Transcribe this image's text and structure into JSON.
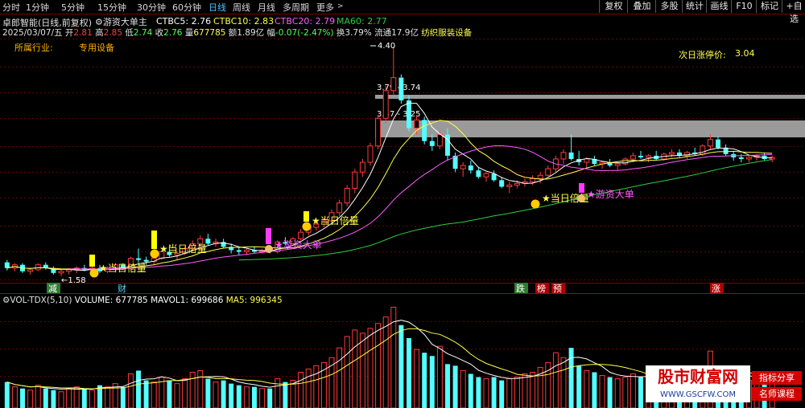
{
  "toolbar": {
    "periods": [
      "分时",
      "1分钟",
      "5分钟",
      "15分钟",
      "30分钟",
      "60分钟",
      "日线",
      "周线",
      "月线",
      "多周期",
      "更多"
    ],
    "active_period": "日线",
    "right_buttons": [
      "复权",
      "叠加",
      "多股",
      "统计",
      "画线",
      "F10",
      "标记",
      "+自选"
    ]
  },
  "header": {
    "stock_title": "卓郎智能(日线,前复权)",
    "indicator_name": "游资大单主",
    "ctbc5_label": "CTBC5: 2.76",
    "ctbc10_label": "CTBC10: 2.83",
    "ctbc20_label": "CTBC20: 2.79",
    "ma60_label": "MA60: 2.77",
    "date": "2025/03/07/五",
    "open_label": "开",
    "open": "2.81",
    "high_label": "高",
    "high": "2.85",
    "low_label": "低",
    "low": "2.74",
    "close_label": "收",
    "close": "2.76",
    "volume_label": "量",
    "volume": "677785",
    "amount_label": "额",
    "amount": "1.89亿",
    "change_label": "幅",
    "change": "-0.07(-2.47%)",
    "turnover_label": "换",
    "turnover": "3.79%",
    "float_label": "流通",
    "float_shares": "17.9亿",
    "sector": "纺织服装设备"
  },
  "info": {
    "industry_label": "所属行业:",
    "industry": "专用设备",
    "limit_label": "次日涨停价:",
    "limit_price": "3.04"
  },
  "annotations": {
    "max_price": "4.40",
    "min_price": "1.58",
    "zone1": "3.79 - 3.74",
    "zone2": "3.47 - 3.25",
    "signal_double": "当日倍量",
    "signal_hot": "游资大单"
  },
  "bottom_tags": [
    "减",
    "财",
    "跌",
    "榜",
    "预",
    "涨"
  ],
  "volume_panel": {
    "title": "VOL-TDX(5,10)",
    "volume_label": "VOLUME: 677785",
    "mavol1_label": "MAVOL1: 699686",
    "ma5_label": "MA5: 996345"
  },
  "watermark": {
    "site": "股市财富网",
    "url": "WWW.GSCFW.COM",
    "tag1": "指标分享",
    "tag2": "名师课程"
  },
  "colors": {
    "up": "#ff3b3b",
    "down": "#54ffff",
    "ma5": "#ffffff",
    "ma10": "#ffff4a",
    "ma20": "#ff5cff",
    "ma60": "#2ecc40",
    "zone": "#9a9a9a"
  },
  "chart_data": {
    "type": "candlestick",
    "price_range": [
      1.5,
      4.5
    ],
    "candles": [
      [
        1.75,
        1.78,
        1.65,
        1.68
      ],
      [
        1.68,
        1.74,
        1.64,
        1.72
      ],
      [
        1.72,
        1.74,
        1.62,
        1.64
      ],
      [
        1.64,
        1.68,
        1.6,
        1.66
      ],
      [
        1.66,
        1.74,
        1.64,
        1.72
      ],
      [
        1.72,
        1.75,
        1.66,
        1.68
      ],
      [
        1.68,
        1.7,
        1.6,
        1.62
      ],
      [
        1.62,
        1.66,
        1.58,
        1.64
      ],
      [
        1.64,
        1.68,
        1.6,
        1.66
      ],
      [
        1.66,
        1.7,
        1.62,
        1.68
      ],
      [
        1.68,
        1.72,
        1.64,
        1.66
      ],
      [
        1.66,
        1.7,
        1.62,
        1.68
      ],
      [
        1.68,
        1.72,
        1.62,
        1.64
      ],
      [
        1.64,
        1.7,
        1.62,
        1.68
      ],
      [
        1.68,
        1.74,
        1.66,
        1.72
      ],
      [
        1.72,
        1.74,
        1.66,
        1.68
      ],
      [
        1.68,
        1.82,
        1.66,
        1.8
      ],
      [
        1.8,
        1.92,
        1.74,
        1.78
      ],
      [
        1.78,
        1.82,
        1.72,
        1.76
      ],
      [
        1.76,
        1.82,
        1.72,
        1.8
      ],
      [
        1.8,
        1.9,
        1.78,
        1.88
      ],
      [
        1.88,
        1.96,
        1.82,
        1.84
      ],
      [
        1.84,
        1.88,
        1.78,
        1.86
      ],
      [
        1.86,
        1.94,
        1.84,
        1.92
      ],
      [
        1.92,
        2.02,
        1.88,
        1.98
      ],
      [
        1.98,
        2.08,
        1.94,
        2.04
      ],
      [
        2.04,
        2.1,
        1.96,
        1.98
      ],
      [
        1.98,
        2.04,
        1.94,
        2.0
      ],
      [
        2.0,
        2.04,
        1.92,
        1.94
      ],
      [
        1.94,
        1.98,
        1.86,
        1.9
      ],
      [
        1.9,
        1.94,
        1.84,
        1.88
      ],
      [
        1.88,
        1.92,
        1.84,
        1.9
      ],
      [
        1.9,
        1.94,
        1.86,
        1.88
      ],
      [
        1.88,
        1.92,
        1.86,
        1.9
      ],
      [
        1.9,
        1.92,
        1.86,
        1.88
      ],
      [
        1.88,
        2.02,
        1.86,
        2.0
      ],
      [
        2.0,
        2.06,
        1.96,
        1.98
      ],
      [
        1.98,
        2.06,
        1.96,
        2.04
      ],
      [
        2.04,
        2.16,
        2.02,
        2.12
      ],
      [
        2.12,
        2.22,
        2.08,
        2.18
      ],
      [
        2.18,
        2.26,
        2.14,
        2.22
      ],
      [
        2.22,
        2.3,
        2.18,
        2.26
      ],
      [
        2.26,
        2.4,
        2.24,
        2.36
      ],
      [
        2.36,
        2.52,
        2.32,
        2.48
      ],
      [
        2.48,
        2.7,
        2.44,
        2.66
      ],
      [
        2.66,
        2.9,
        2.6,
        2.86
      ],
      [
        2.86,
        3.02,
        2.8,
        2.98
      ],
      [
        2.98,
        3.22,
        2.94,
        3.18
      ],
      [
        3.18,
        3.56,
        3.14,
        3.52
      ],
      [
        3.52,
        3.92,
        3.46,
        3.86
      ],
      [
        3.86,
        4.4,
        3.8,
        4.02
      ],
      [
        4.02,
        4.06,
        3.7,
        3.74
      ],
      [
        3.74,
        3.8,
        3.36,
        3.4
      ],
      [
        3.4,
        3.56,
        3.32,
        3.5
      ],
      [
        3.5,
        3.54,
        3.2,
        3.24
      ],
      [
        3.24,
        3.32,
        3.12,
        3.18
      ],
      [
        3.18,
        3.36,
        3.14,
        3.32
      ],
      [
        3.32,
        3.4,
        3.0,
        3.06
      ],
      [
        3.06,
        3.1,
        2.86,
        2.9
      ],
      [
        2.9,
        2.98,
        2.8,
        2.94
      ],
      [
        2.94,
        3.0,
        2.84,
        2.88
      ],
      [
        2.88,
        2.92,
        2.78,
        2.8
      ],
      [
        2.8,
        2.86,
        2.74,
        2.84
      ],
      [
        2.84,
        2.88,
        2.74,
        2.76
      ],
      [
        2.76,
        2.8,
        2.66,
        2.68
      ],
      [
        2.68,
        2.74,
        2.6,
        2.7
      ],
      [
        2.7,
        2.76,
        2.66,
        2.72
      ],
      [
        2.72,
        2.78,
        2.68,
        2.74
      ],
      [
        2.74,
        2.82,
        2.7,
        2.78
      ],
      [
        2.78,
        2.86,
        2.72,
        2.82
      ],
      [
        2.82,
        2.94,
        2.8,
        2.9
      ],
      [
        2.9,
        3.06,
        2.86,
        3.02
      ],
      [
        3.02,
        3.14,
        2.96,
        3.1
      ],
      [
        3.1,
        3.32,
        3.0,
        3.02
      ],
      [
        3.02,
        3.12,
        2.94,
        2.98
      ],
      [
        2.98,
        3.04,
        2.9,
        3.02
      ],
      [
        3.02,
        3.06,
        2.94,
        2.96
      ],
      [
        2.96,
        3.0,
        2.9,
        2.98
      ],
      [
        2.98,
        3.02,
        2.92,
        2.94
      ],
      [
        2.94,
        2.98,
        2.88,
        2.96
      ],
      [
        2.96,
        3.04,
        2.94,
        3.02
      ],
      [
        3.02,
        3.1,
        2.98,
        3.06
      ],
      [
        3.06,
        3.12,
        3.02,
        3.04
      ],
      [
        3.04,
        3.08,
        2.98,
        3.06
      ],
      [
        3.06,
        3.12,
        3.0,
        3.02
      ],
      [
        3.02,
        3.1,
        3.0,
        3.08
      ],
      [
        3.08,
        3.14,
        3.04,
        3.1
      ],
      [
        3.1,
        3.14,
        3.04,
        3.06
      ],
      [
        3.06,
        3.12,
        3.02,
        3.1
      ],
      [
        3.1,
        3.16,
        3.06,
        3.08
      ],
      [
        3.08,
        3.2,
        3.06,
        3.18
      ],
      [
        3.18,
        3.32,
        3.14,
        3.26
      ],
      [
        3.26,
        3.3,
        3.14,
        3.16
      ],
      [
        3.16,
        3.2,
        3.06,
        3.08
      ],
      [
        3.08,
        3.12,
        3.0,
        3.04
      ],
      [
        3.04,
        3.08,
        2.98,
        3.02
      ],
      [
        3.02,
        3.06,
        2.98,
        3.04
      ],
      [
        3.04,
        3.08,
        3.0,
        3.06
      ],
      [
        3.06,
        3.1,
        3.0,
        3.02
      ],
      [
        3.02,
        3.06,
        2.98,
        3.04
      ]
    ],
    "volume": [
      3.2,
      2.6,
      2.4,
      2.2,
      2.8,
      2.4,
      2.2,
      2.0,
      2.4,
      2.6,
      2.4,
      2.2,
      2.8,
      2.6,
      3.0,
      2.6,
      4.2,
      4.6,
      3.4,
      3.2,
      3.8,
      3.4,
      3.0,
      3.6,
      4.4,
      4.6,
      3.6,
      3.2,
      3.4,
      3.0,
      2.8,
      2.6,
      2.6,
      2.4,
      2.4,
      3.6,
      3.2,
      3.4,
      4.4,
      4.8,
      5.2,
      5.6,
      6.2,
      7.4,
      8.8,
      9.6,
      9.2,
      9.8,
      10.4,
      11.2,
      12.4,
      10.2,
      8.6,
      7.2,
      6.8,
      6.4,
      7.6,
      5.4,
      5.2,
      4.6,
      4.2,
      3.8,
      3.6,
      3.8,
      3.4,
      3.6,
      3.8,
      4.2,
      4.4,
      5.0,
      5.6,
      6.8,
      6.2,
      7.4,
      5.2,
      4.6,
      4.4,
      4.0,
      3.8,
      3.6,
      3.8,
      4.2,
      3.8,
      4.0,
      3.6,
      3.8,
      4.2,
      3.6,
      3.8,
      4.0,
      4.6,
      7.0,
      5.0,
      4.2,
      3.8,
      3.6,
      3.4,
      3.6,
      3.4,
      3.2
    ]
  }
}
